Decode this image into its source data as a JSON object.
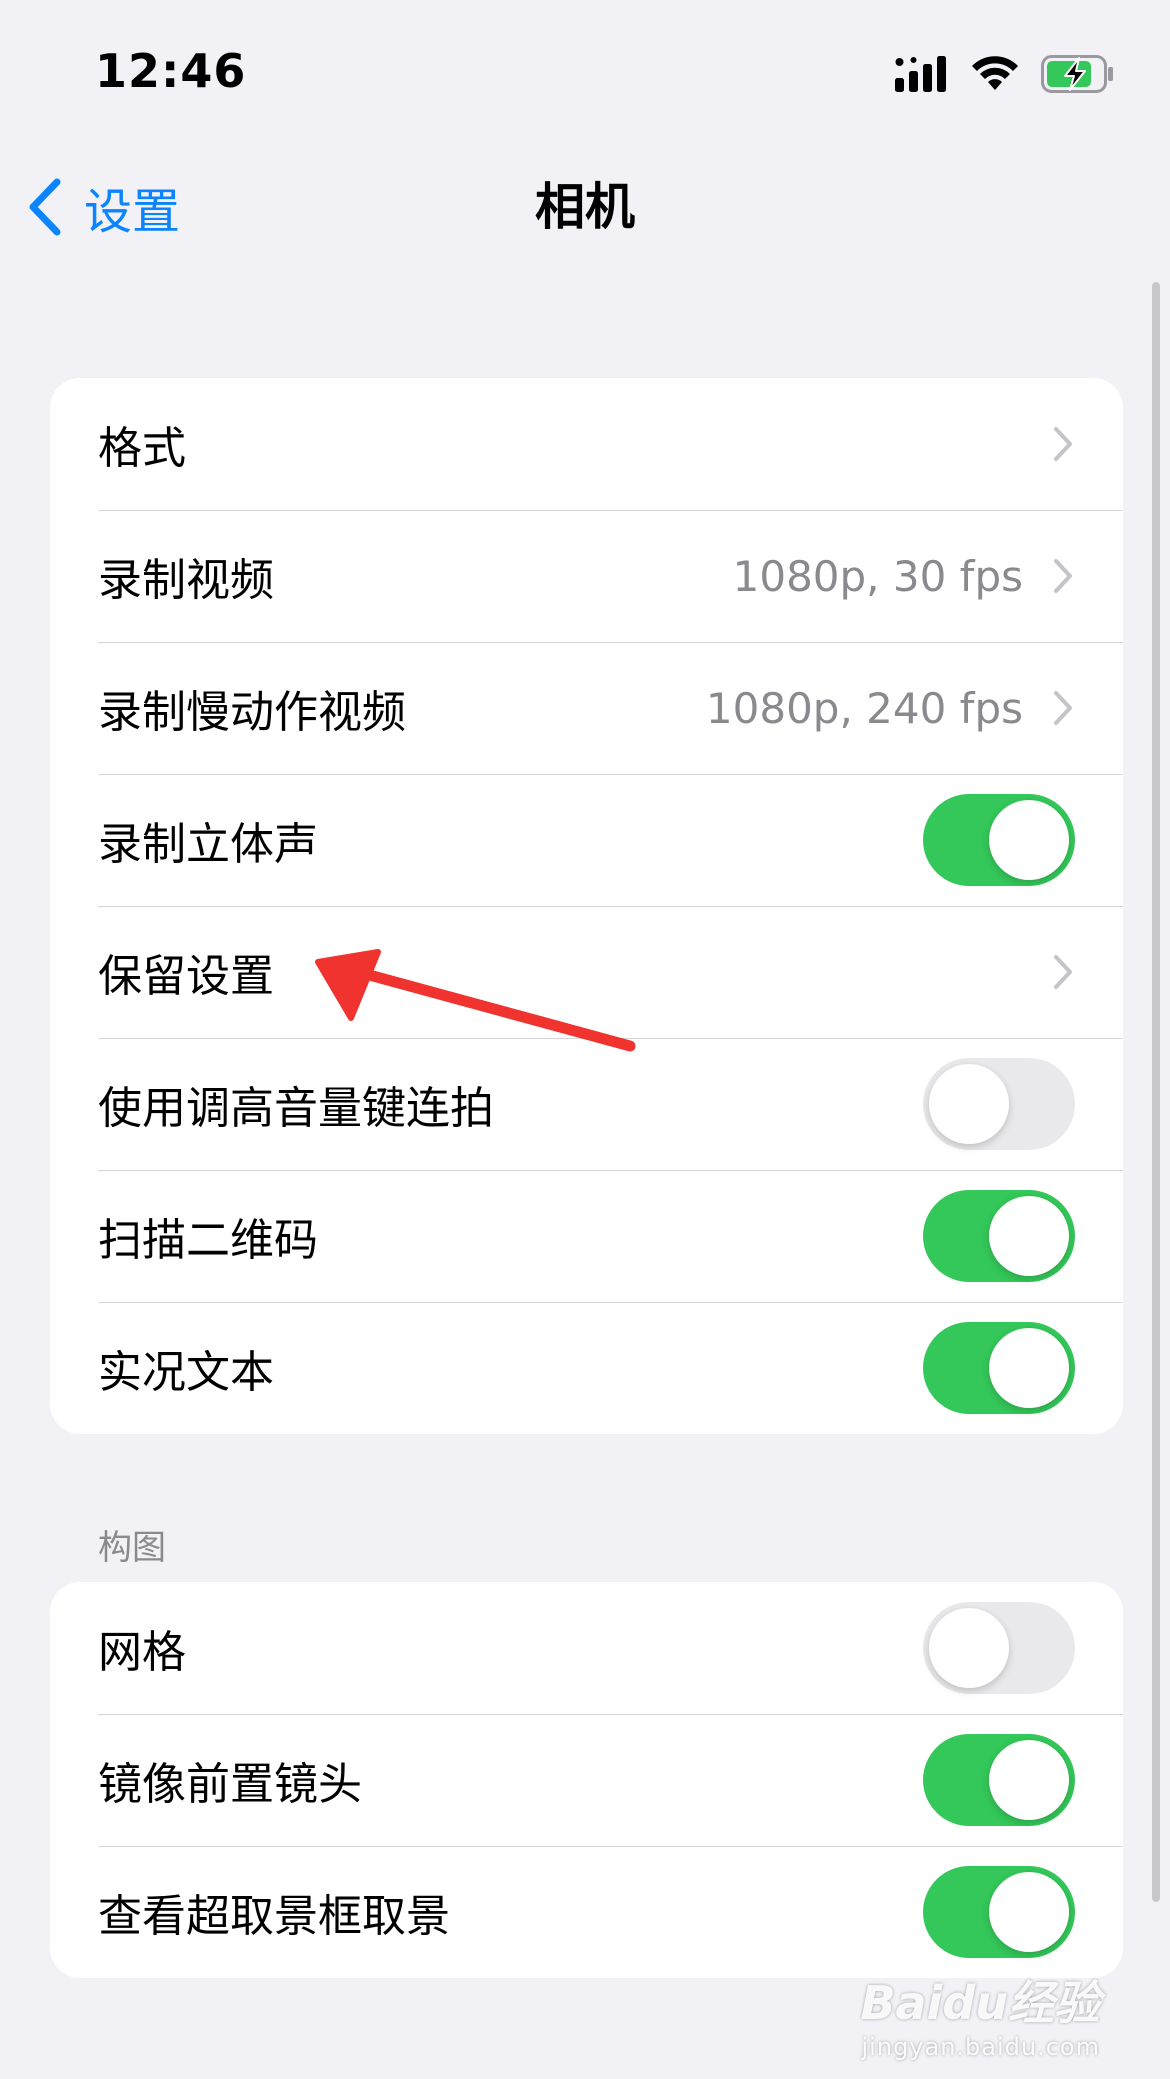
{
  "status_bar": {
    "time": "12:46"
  },
  "nav": {
    "back_label": "设置",
    "title": "相机"
  },
  "colors": {
    "accent": "#0a84ff",
    "toggle_on": "#34c759",
    "toggle_off": "#e9e9eb",
    "annotation_arrow": "#f0332f"
  },
  "main_group": {
    "rows": [
      {
        "label": "格式",
        "value": "",
        "type": "link"
      },
      {
        "label": "录制视频",
        "value": "1080p, 30 fps",
        "type": "link"
      },
      {
        "label": "录制慢动作视频",
        "value": "1080p, 240 fps",
        "type": "link"
      },
      {
        "label": "录制立体声",
        "type": "toggle",
        "on": true
      },
      {
        "label": "保留设置",
        "value": "",
        "type": "link"
      },
      {
        "label": "使用调高音量键连拍",
        "type": "toggle",
        "on": false
      },
      {
        "label": "扫描二维码",
        "type": "toggle",
        "on": true
      },
      {
        "label": "实况文本",
        "type": "toggle",
        "on": true
      }
    ]
  },
  "composition_group": {
    "header": "构图",
    "rows": [
      {
        "label": "网格",
        "type": "toggle",
        "on": false
      },
      {
        "label": "镜像前置镜头",
        "type": "toggle",
        "on": true
      },
      {
        "label": "查看超取景框取景",
        "type": "toggle",
        "on": true
      }
    ]
  },
  "watermark": {
    "logo": "Baidu经验",
    "url": "jingyan.baidu.com"
  }
}
